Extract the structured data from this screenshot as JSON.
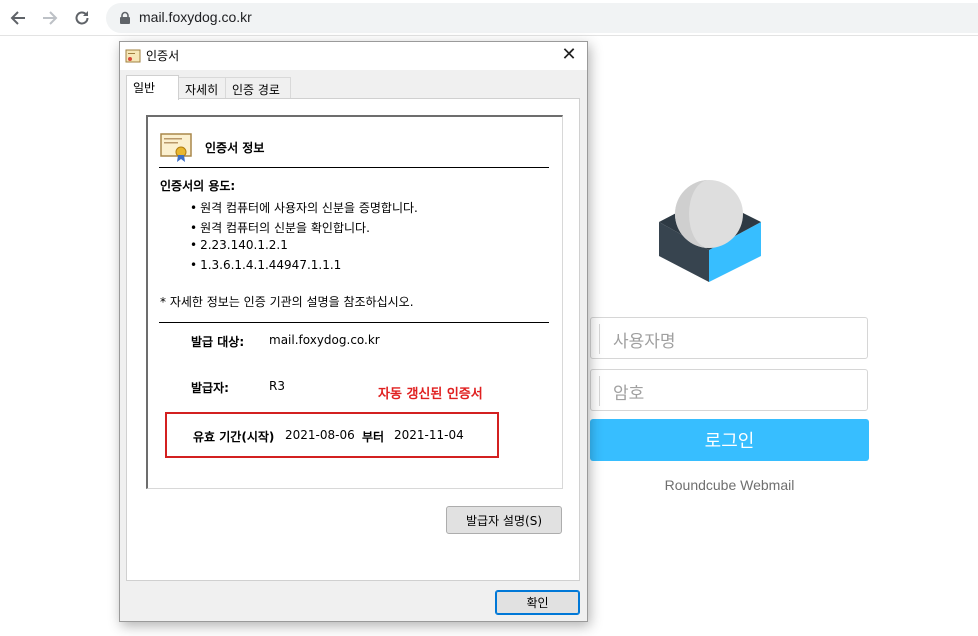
{
  "browser": {
    "url": "mail.foxydog.co.kr"
  },
  "login": {
    "username_placeholder": "사용자명",
    "password_placeholder": "암호",
    "login_button": "로그인",
    "footer": "Roundcube Webmail",
    "accent_color": "#37beff"
  },
  "dialog": {
    "title": "인증서",
    "tabs": [
      "일반",
      "자세히",
      "인증 경로"
    ],
    "cert_info_title": "인증서 정보",
    "purpose_heading": "인증서의 용도:",
    "purposes": [
      "원격 컴퓨터에 사용자의 신분을 증명합니다.",
      "원격 컴퓨터의 신분을 확인합니다.",
      "2.23.140.1.2.1",
      "1.3.6.1.4.1.44947.1.1.1"
    ],
    "note": "* 자세한 정보는 인증 기관의 설명을 참조하십시오.",
    "issued_to_label": "발급 대상:",
    "issued_to_value": "mail.foxydog.co.kr",
    "issuer_label": "발급자:",
    "issuer_value": "R3",
    "validity_label": "유효 기간(시작)",
    "validity_from": "2021-08-06",
    "validity_mid": "부터",
    "validity_to": "2021-11-04",
    "issuer_statement_button": "발급자 설명(S)",
    "ok_button": "확인"
  },
  "annotation": {
    "text": "자동 갱신된 인증서",
    "color": "#e02020"
  }
}
